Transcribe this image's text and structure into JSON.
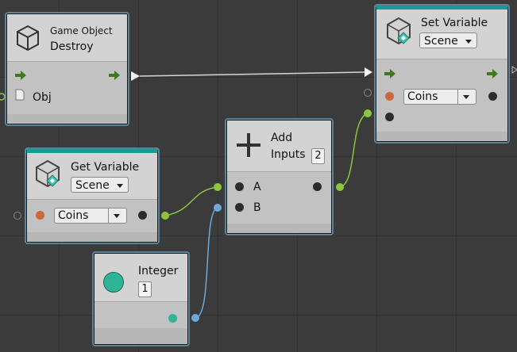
{
  "nodes": {
    "destroy": {
      "category": "Game Object",
      "title": "Destroy",
      "input_label": "Obj"
    },
    "set_variable": {
      "title": "Set Variable",
      "scope": "Scene",
      "variable": "Coins"
    },
    "get_variable": {
      "title": "Get Variable",
      "scope": "Scene",
      "variable": "Coins"
    },
    "add": {
      "title_line1": "Add",
      "inputs_label": "Inputs",
      "inputs_count": "2",
      "port_a": "A",
      "port_b": "B"
    },
    "integer": {
      "title": "Integer",
      "value": "1"
    }
  },
  "colors": {
    "background": "#3b3b3b",
    "node_body": "#c5c5c5",
    "header_accent": "#1a9a96",
    "control_flow": "#3e7a1d",
    "value_wire_green": "#8cc63f",
    "value_wire_blue": "#6fa8dc",
    "flow_wire": "#d8d8d8",
    "integer_swatch": "#2fb596"
  }
}
